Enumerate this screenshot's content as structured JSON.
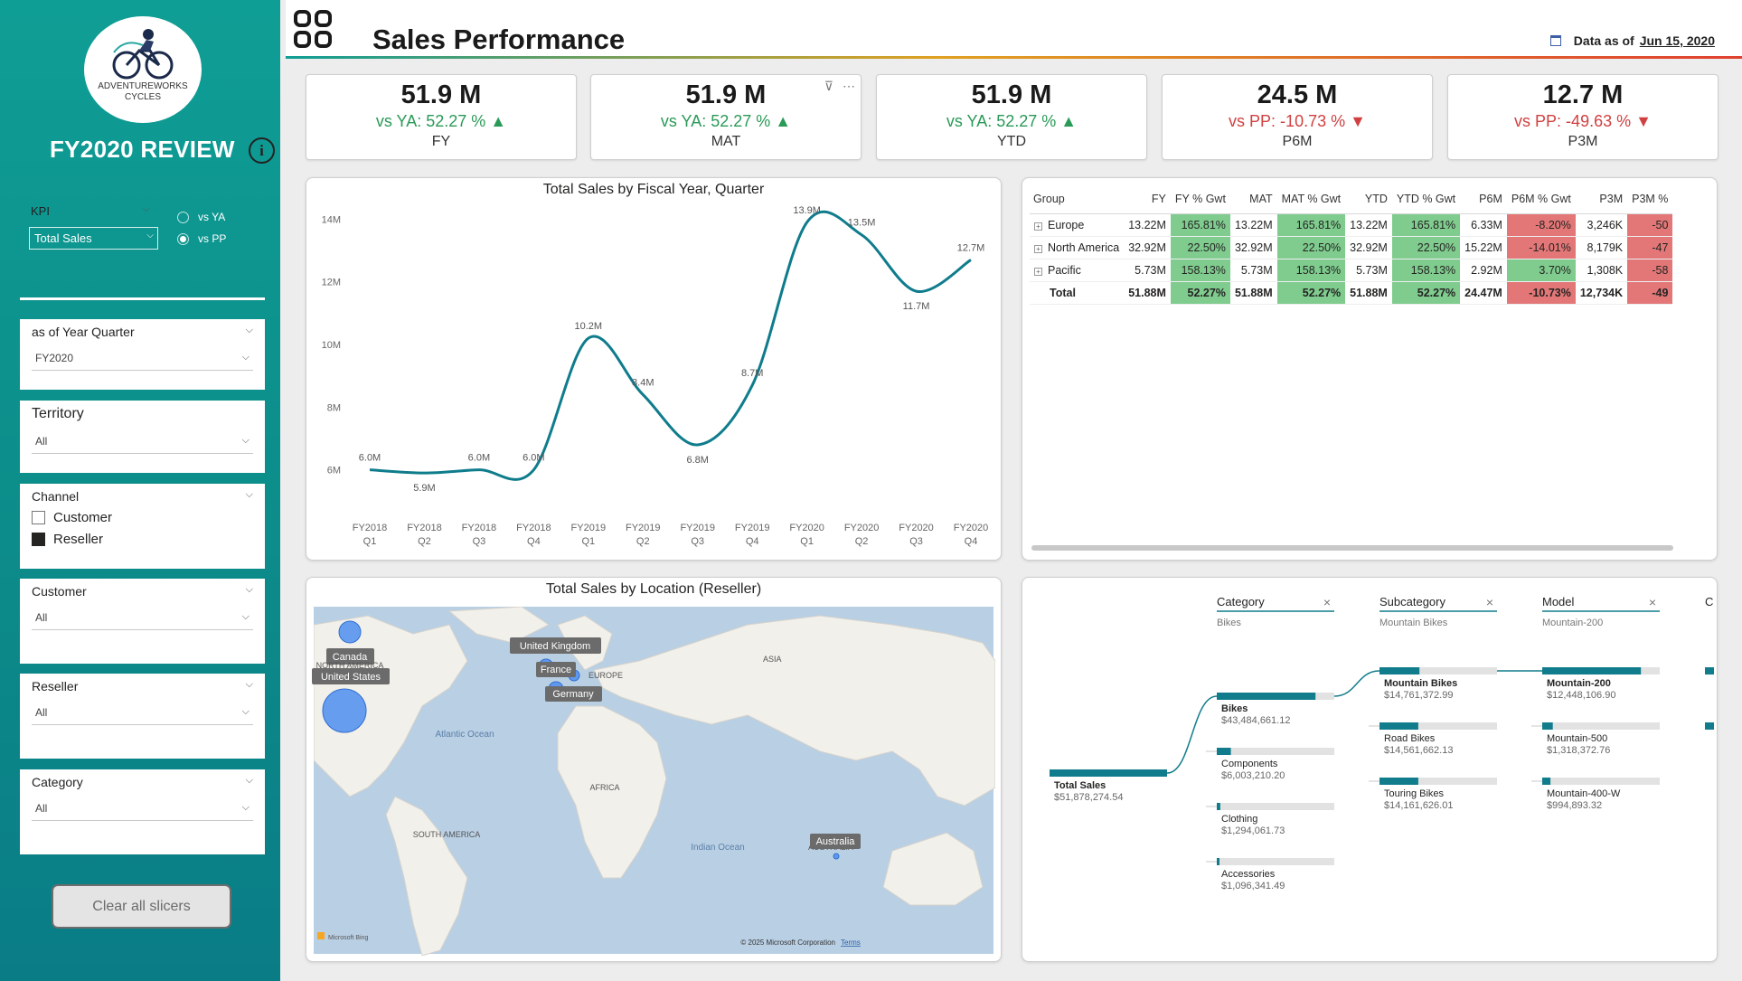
{
  "sidebar": {
    "logo_line1": "ADVENTUREWORKS",
    "logo_line2": "CYCLES",
    "review_title": "FY2020 REVIEW",
    "info_icon": "i",
    "kpi": {
      "label": "KPI",
      "value": "Total Sales"
    },
    "compare_options": [
      {
        "label": "vs YA",
        "selected": false
      },
      {
        "label": "vs PP",
        "selected": true
      }
    ],
    "slicers": {
      "quarter": {
        "label": "as of Year Quarter",
        "value": "FY2020"
      },
      "territory": {
        "label": "Territory",
        "value": "All"
      },
      "channel": {
        "label": "Channel",
        "options": [
          {
            "label": "Customer",
            "checked": false
          },
          {
            "label": "Reseller",
            "checked": true
          }
        ]
      },
      "customer": {
        "label": "Customer",
        "value": "All"
      },
      "reseller": {
        "label": "Reseller",
        "value": "All"
      },
      "category": {
        "label": "Category",
        "value": "All"
      }
    },
    "clear_button": "Clear all slicers"
  },
  "header": {
    "title": "Sales Performance",
    "data_as_of_label": "Data as of",
    "data_as_of_date": "Jun 15, 2020"
  },
  "cards": [
    {
      "value": "51.9 M",
      "delta": "vs YA:  52.27 %",
      "direction": "up",
      "label": "FY"
    },
    {
      "value": "51.9 M",
      "delta": "vs YA:  52.27 %",
      "direction": "up",
      "label": "MAT"
    },
    {
      "value": "51.9 M",
      "delta": "vs YA:  52.27 %",
      "direction": "up",
      "label": "YTD"
    },
    {
      "value": "24.5 M",
      "delta": "vs PP:  -10.73 %",
      "direction": "down",
      "label": "P6M"
    },
    {
      "value": "12.7 M",
      "delta": "vs PP:  -49.63 %",
      "direction": "down",
      "label": "P3M"
    }
  ],
  "line_chart": {
    "title": "Total Sales by Fiscal Year, Quarter"
  },
  "chart_data": {
    "type": "line",
    "title": "Total Sales by Fiscal Year, Quarter",
    "x": [
      "FY2018 Q1",
      "FY2018 Q2",
      "FY2018 Q3",
      "FY2018 Q4",
      "FY2019 Q1",
      "FY2019 Q2",
      "FY2019 Q3",
      "FY2019 Q4",
      "FY2020 Q1",
      "FY2020 Q2",
      "FY2020 Q3",
      "FY2020 Q4"
    ],
    "x_lines": [
      [
        "FY2018",
        "Q1"
      ],
      [
        "FY2018",
        "Q2"
      ],
      [
        "FY2018",
        "Q3"
      ],
      [
        "FY2018",
        "Q4"
      ],
      [
        "FY2019",
        "Q1"
      ],
      [
        "FY2019",
        "Q2"
      ],
      [
        "FY2019",
        "Q3"
      ],
      [
        "FY2019",
        "Q4"
      ],
      [
        "FY2020",
        "Q1"
      ],
      [
        "FY2020",
        "Q2"
      ],
      [
        "FY2020",
        "Q3"
      ],
      [
        "FY2020",
        "Q4"
      ]
    ],
    "values": [
      6.0,
      5.9,
      6.0,
      6.0,
      10.2,
      8.4,
      6.8,
      8.7,
      13.9,
      13.5,
      11.7,
      12.7
    ],
    "labels": [
      "6.0M",
      "5.9M",
      "6.0M",
      "6.0M",
      "10.2M",
      "8.4M",
      "6.8M",
      "8.7M",
      "13.9M",
      "13.5M",
      "11.7M",
      "12.7M"
    ],
    "y_ticks": [
      6,
      8,
      10,
      12,
      14
    ],
    "y_tick_labels": [
      "6M",
      "8M",
      "10M",
      "12M",
      "14M"
    ],
    "ylim": [
      5.5,
      14.3
    ],
    "color": "#0f7c8c"
  },
  "matrix": {
    "columns": [
      "Group",
      "FY",
      "FY % Gwt",
      "MAT",
      "MAT % Gwt",
      "YTD",
      "YTD % Gwt",
      "P6M",
      "P6M % Gwt",
      "P3M",
      "P3M %"
    ],
    "rows": [
      {
        "group": "Europe",
        "cells": [
          "13.22M",
          "165.81%",
          "13.22M",
          "165.81%",
          "13.22M",
          "165.81%",
          "6.33M",
          "-8.20%",
          "3,246K",
          "-50"
        ]
      },
      {
        "group": "North America",
        "cells": [
          "32.92M",
          "22.50%",
          "32.92M",
          "22.50%",
          "32.92M",
          "22.50%",
          "15.22M",
          "-14.01%",
          "8,179K",
          "-47"
        ]
      },
      {
        "group": "Pacific",
        "cells": [
          "5.73M",
          "158.13%",
          "5.73M",
          "158.13%",
          "5.73M",
          "158.13%",
          "2.92M",
          "3.70%",
          "1,308K",
          "-58"
        ]
      }
    ],
    "total": {
      "group": "Total",
      "cells": [
        "51.88M",
        "52.27%",
        "51.88M",
        "52.27%",
        "51.88M",
        "52.27%",
        "24.47M",
        "-10.73%",
        "12,734K",
        "-49"
      ]
    },
    "expand_icon": "+"
  },
  "map": {
    "title": "Total Sales by Location (Reseller)",
    "labels": {
      "canada": "Canada",
      "north_america": "NORTH AMERICA",
      "united_states": "United States",
      "united_kingdom": "United Kingdom",
      "france": "France",
      "germany": "Germany",
      "europe": "EUROPE",
      "asia": "ASIA",
      "atlantic": "Atlantic Ocean",
      "africa": "AFRICA",
      "south_america": "SOUTH AMERICA",
      "indian": "Indian Ocean",
      "australia": "Australia",
      "australia_region": "AUSTRALIA",
      "bing": "Microsoft Bing",
      "copyright": "© 2025 Microsoft Corporation",
      "terms": "Terms"
    },
    "bubble_color": "#4f8ef0"
  },
  "decomp": {
    "levels": [
      {
        "header": "Category",
        "selected": "Bikes"
      },
      {
        "header": "Subcategory",
        "selected": "Mountain Bikes"
      },
      {
        "header": "Model",
        "selected": "Mountain-200"
      },
      {
        "header": "C",
        "selected": ""
      }
    ],
    "root": {
      "name": "Total Sales",
      "value": "$51,878,274.54"
    },
    "categories": [
      {
        "name": "Bikes",
        "value": "$43,484,661.12",
        "share": 0.84
      },
      {
        "name": "Components",
        "value": "$6,003,210.20",
        "share": 0.12
      },
      {
        "name": "Clothing",
        "value": "$1,294,061.73",
        "share": 0.03
      },
      {
        "name": "Accessories",
        "value": "$1,096,341.49",
        "share": 0.02
      }
    ],
    "subcategories": [
      {
        "name": "Mountain Bikes",
        "value": "$14,761,372.99",
        "share": 0.34
      },
      {
        "name": "Road Bikes",
        "value": "$14,561,662.13",
        "share": 0.33
      },
      {
        "name": "Touring Bikes",
        "value": "$14,161,626.01",
        "share": 0.33
      }
    ],
    "models": [
      {
        "name": "Mountain-200",
        "value": "$12,448,106.90",
        "share": 0.84
      },
      {
        "name": "Mountain-500",
        "value": "$1,318,372.76",
        "share": 0.09
      },
      {
        "name": "Mountain-400-W",
        "value": "$994,893.32",
        "share": 0.07
      }
    ],
    "close_icon": "×",
    "bar_color": "#117c8c"
  }
}
